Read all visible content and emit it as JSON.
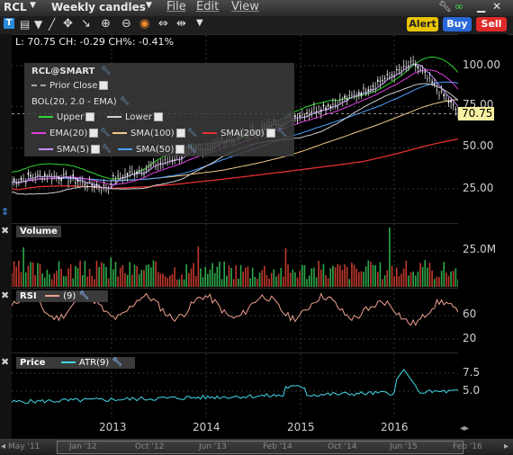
{
  "toolbar": {
    "symbol": "RCL",
    "period": "Weekly candles",
    "menus": [
      "File",
      "Edit",
      "View"
    ],
    "alert_label": "Alert",
    "buy_label": "Buy",
    "sell_label": "Sell"
  },
  "quote_line": "L: 70.75 CH: -0.29 CH%: -0.41%",
  "legend": {
    "title": "RCL@SMART",
    "prior_close": "Prior Close",
    "bol": "BOL(20, 2.0 - EMA)",
    "upper": "Upper",
    "lower": "Lower",
    "ema20": "EMA(20)",
    "sma100": "SMA(100)",
    "sma200": "SMA(200)",
    "sma5": "SMA(5)",
    "sma50": "SMA(50)",
    "colors": {
      "upper": "#33d433",
      "lower": "#cfcfcf",
      "ema20": "#e040e0",
      "sma100": "#f4c989",
      "sma200": "#e23030",
      "sma5": "#c090ff",
      "sma50": "#4aa0ff"
    }
  },
  "price_axis": [
    "100.00",
    "75.00",
    "50.00",
    "25.00"
  ],
  "last_price": "70.75",
  "volume": {
    "title": "Volume",
    "axis": [
      "25.0M"
    ]
  },
  "rsi": {
    "title": "RSI",
    "param": "(9)",
    "axis": [
      "60",
      "20"
    ]
  },
  "atr": {
    "title": "Price",
    "label": "ATR(9)",
    "axis": [
      "7.5",
      "5.0"
    ]
  },
  "x_labels": [
    "2013",
    "2014",
    "2015",
    "2016"
  ],
  "timeline": [
    "May '11",
    "Jan '12",
    "Oct '12",
    "Jun '13",
    "Feb '14",
    "Oct '14",
    "Jun '15",
    "Feb '16"
  ]
}
